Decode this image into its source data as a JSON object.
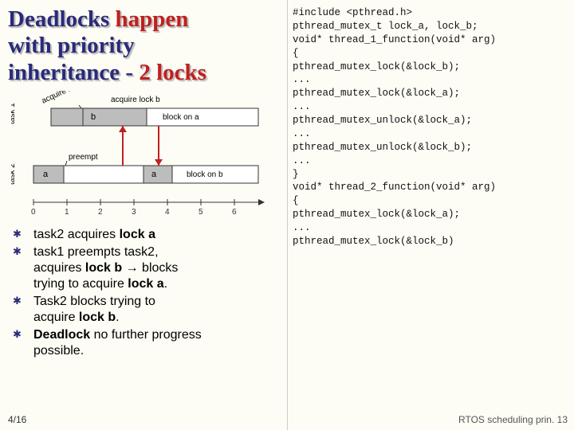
{
  "title": {
    "line1a": "Deadlocks ",
    "line1b": "  happen",
    "line2": "with priority",
    "line3a": "inheritance - ",
    "line3b": "2 locks"
  },
  "diagram": {
    "task1": "task 1",
    "task2": "task 2",
    "acq_a": "acquire lock a",
    "acq_b": "acquire lock b",
    "preempt": "preempt",
    "block_on_a": "block on a",
    "block_on_b": "block on b",
    "a": "a",
    "b": "b",
    "ticks": [
      "0",
      "1",
      "2",
      "3",
      "4",
      "5",
      "6"
    ]
  },
  "bullets": {
    "b1_a": "task2  acquires ",
    "b1_b": "lock a",
    "b2_a": "task1 preempts task2,",
    "b2_b": "acquires ",
    "b2_c": "lock b",
    "b2_d": " →  blocks",
    "b2_e": "trying to acquire ",
    "b2_f": "lock a",
    "b2_g": ".",
    "b3_a": "Task2  blocks trying to",
    "b3_b": "acquire ",
    "b3_c": "lock b",
    "b3_d": ".",
    "b4_a": "Deadlock ",
    "b4_b": "no further progress",
    "b4_c": "possible."
  },
  "slideno": "4/16",
  "footer": "RTOS scheduling prin. 13",
  "code": {
    "l1": "#include <pthread.h>",
    "l2": "pthread_mutex_t lock_a, lock_b;",
    "l3": "",
    "l4": "void* thread_1_function(void* arg)",
    "l5": "{",
    "l6": " pthread_mutex_lock(&lock_b);",
    "l7": "   ...",
    "l8": "   pthread_mutex_lock(&lock_a);",
    "l9": "   ...",
    "l10": "   pthread_mutex_unlock(&lock_a);",
    "l11": "   ...",
    "l12": "   pthread_mutex_unlock(&lock_b);",
    "l13": "   ...",
    "l14": "}",
    "l15": "void* thread_2_function(void* arg)",
    "l16": "{",
    "l17": "   pthread_mutex_lock(&lock_a);",
    "l18": "   ...",
    "l19": "   pthread_mutex_lock(&lock_b)"
  }
}
